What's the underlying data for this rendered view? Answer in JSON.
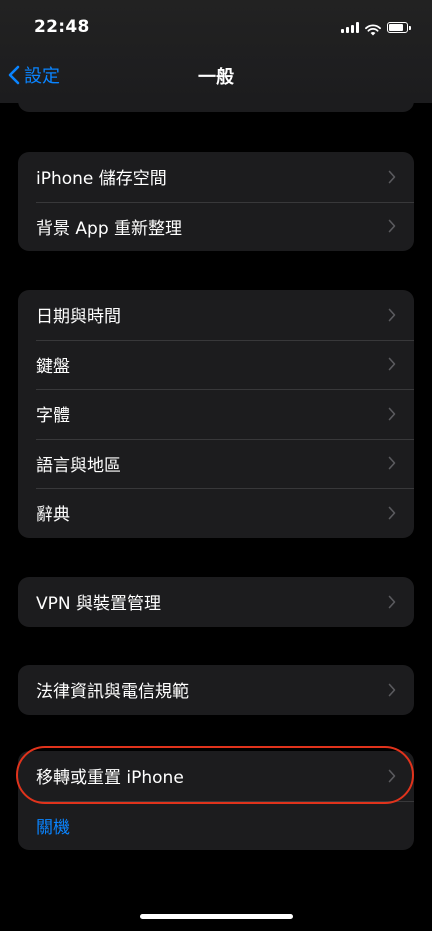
{
  "status_bar": {
    "time": "22:48",
    "battery_level": 0.85
  },
  "nav": {
    "back_label": "設定",
    "title": "一般"
  },
  "groups": [
    {
      "items": [
        {
          "label": "iPhone 儲存空間"
        },
        {
          "label": "背景 App 重新整理"
        }
      ]
    },
    {
      "items": [
        {
          "label": "日期與時間"
        },
        {
          "label": "鍵盤"
        },
        {
          "label": "字體"
        },
        {
          "label": "語言與地區"
        },
        {
          "label": "辭典"
        }
      ]
    },
    {
      "items": [
        {
          "label": "VPN 與裝置管理"
        }
      ]
    },
    {
      "items": [
        {
          "label": "法律資訊與電信規範"
        }
      ]
    },
    {
      "items": [
        {
          "label": "移轉或重置 iPhone"
        },
        {
          "label": "關機"
        }
      ]
    }
  ],
  "colors": {
    "accent": "#0a84ff",
    "highlight": "#e0331c",
    "group_background": "#1c1c1e"
  }
}
